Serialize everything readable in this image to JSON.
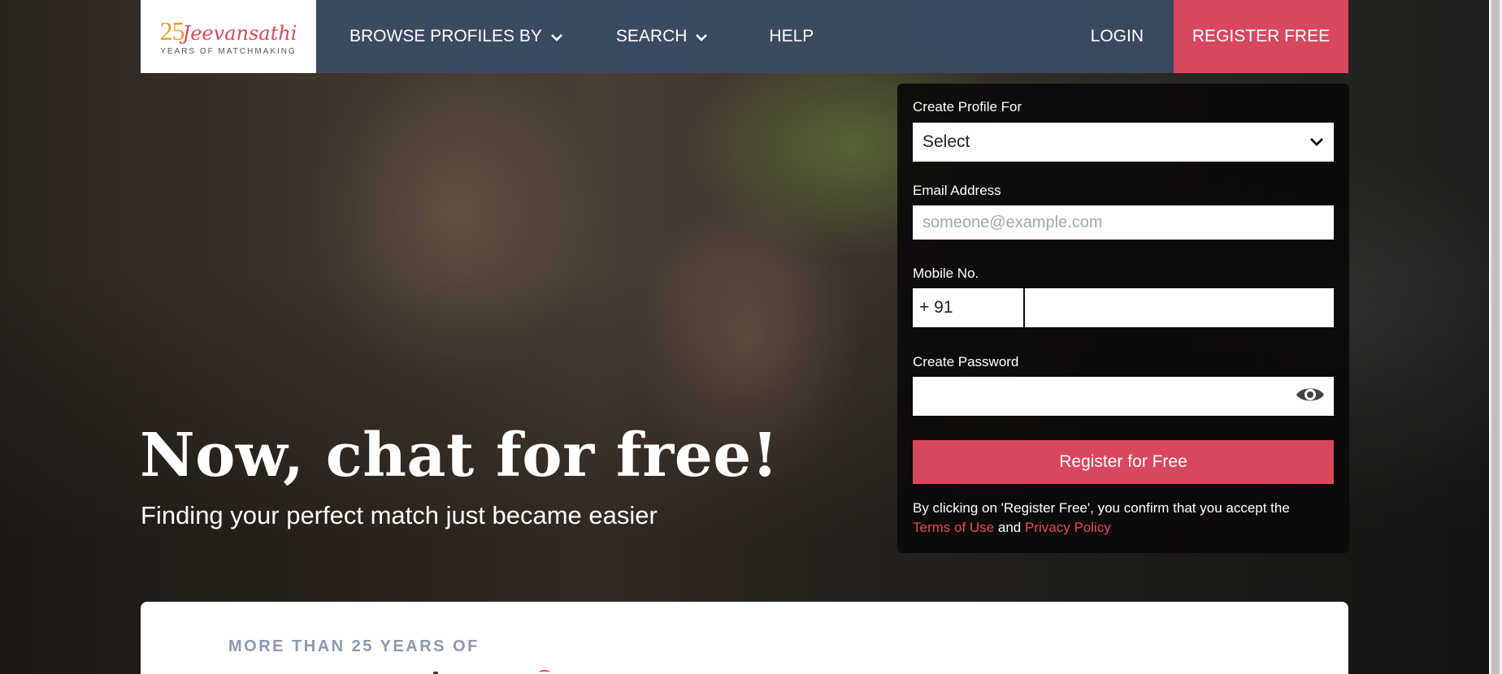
{
  "brand": {
    "logo_number": "25",
    "logo_name": "Jeevansathi",
    "logo_tagline": "YEARS OF MATCHMAKING"
  },
  "nav": {
    "browse_label": "BROWSE PROFILES BY",
    "search_label": "SEARCH",
    "help_label": "HELP",
    "login_label": "LOGIN",
    "register_label": "REGISTER FREE"
  },
  "hero": {
    "title": "Now, chat for free!",
    "subtitle": "Finding your perfect match just became easier"
  },
  "form": {
    "profile_for_label": "Create Profile For",
    "profile_for_value": "Select",
    "email_label": "Email Address",
    "email_placeholder": "someone@example.com",
    "mobile_label": "Mobile No.",
    "country_code": "+ 91",
    "password_label": "Create Password",
    "submit_label": "Register for Free",
    "consent_text": "By clicking on 'Register Free', you confirm that you accept the",
    "terms_link": "Terms of Use",
    "consent_and": "and",
    "privacy_link": "Privacy Policy"
  },
  "bottom": {
    "kicker": "MORE THAN 25 YEARS OF"
  },
  "colors": {
    "brand_accent": "#d9475f",
    "nav_bg": "#3a4c64",
    "logo_orange": "#e8a028"
  }
}
